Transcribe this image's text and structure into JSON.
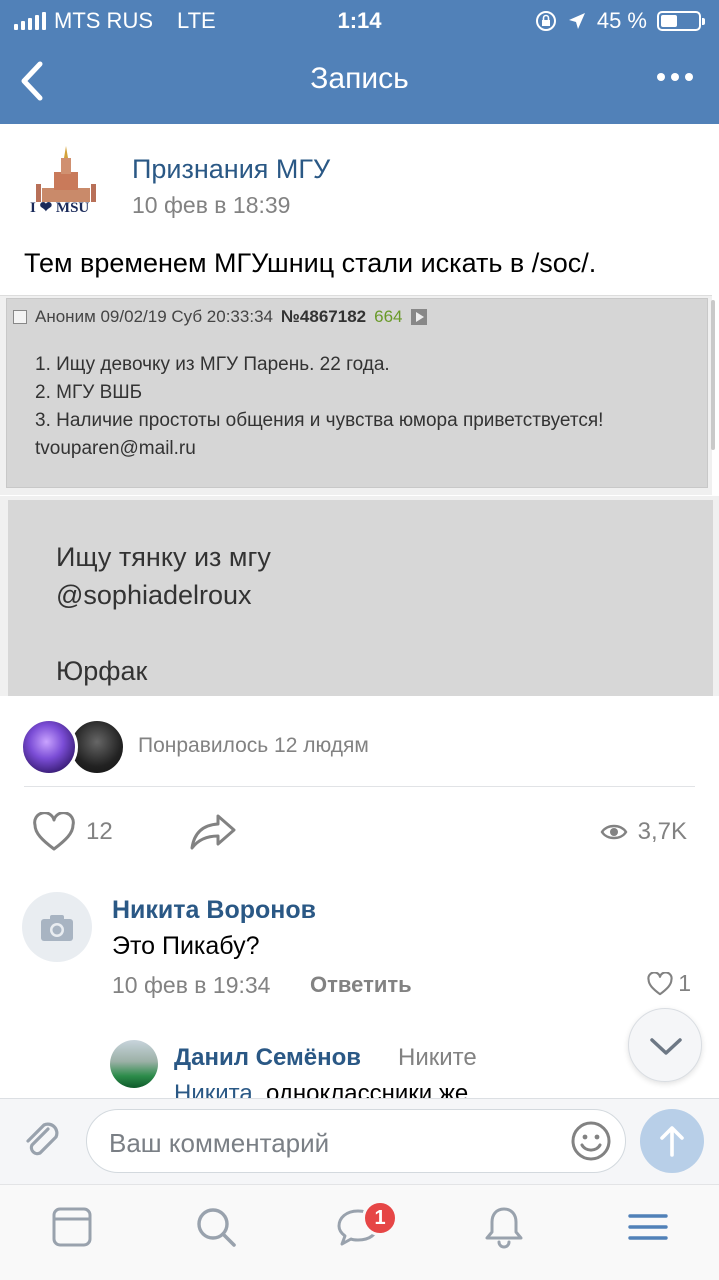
{
  "status_bar": {
    "carrier": "MTS RUS",
    "network": "LTE",
    "time": "1:14",
    "battery": "45 %",
    "battery_level": 0.45
  },
  "nav": {
    "title": "Запись"
  },
  "post": {
    "group_name": "Признания МГУ",
    "date": "10 фев в 18:39",
    "logo_text": "I ❤ MSU",
    "text": "Тем временем МГУшниц стали искать в /soc/.",
    "screenshot1": {
      "meta_author": "Аноним 09/02/19 Суб 20:33:34",
      "meta_number": "№4867182",
      "meta_count": "664",
      "lines": [
        "1. Ищу девочку из МГУ Парень. 22 года.",
        "2. МГУ ВШБ",
        "3. Наличие простоты общения и чувства юмора приветствуется!",
        "tvouparen@mail.ru"
      ]
    },
    "screenshot2": {
      "lines": [
        "Ищу тянку из мгу",
        "@sophiadelroux",
        "",
        "Юрфак"
      ]
    },
    "likes_text": "Понравилось 12 людям",
    "like_count": "12",
    "views": "3,7K"
  },
  "comments": [
    {
      "author": "Никита Воронов",
      "text": "Это Пикабу?",
      "date": "10 фев в 19:34",
      "reply_label": "Ответить",
      "likes": "1"
    }
  ],
  "reply": {
    "author": "Данил Семёнов",
    "to": "Никите",
    "mention": "Никита",
    "text": ", одноклассники же"
  },
  "composer": {
    "placeholder": "Ваш комментарий"
  },
  "tabbar": {
    "badge": "1"
  },
  "colors": {
    "header": "#5181b8",
    "link": "#2a5885",
    "muted": "#828282",
    "badge": "#e64646"
  }
}
